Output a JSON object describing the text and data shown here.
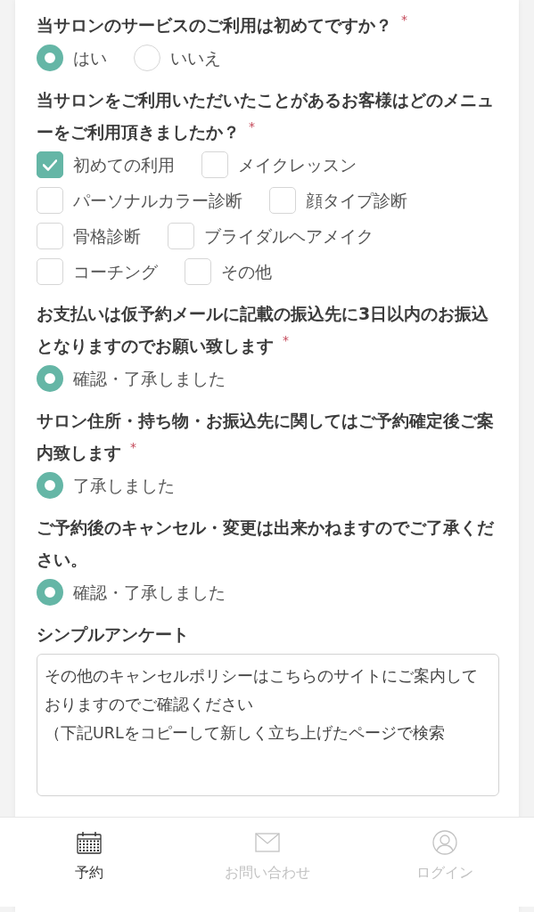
{
  "questions": [
    {
      "kind": "radio",
      "title": "当サロンのサービスのご利用は初めてですか？$^{*}$",
      "options": [
        {
          "label": "はい",
          "selected": true
        },
        {
          "label": "いいえ",
          "selected": false
        }
      ]
    },
    {
      "kind": "checkbox",
      "title": "当サロンをご利用いただいたことがあるお客様はどのメニューをご利用頂きましたか？$^{*}$",
      "options": [
        {
          "label": "初めての利用",
          "checked": true
        },
        {
          "label": "メイクレッスン",
          "checked": false
        },
        {
          "label": "パーソナルカラー診断",
          "checked": false
        },
        {
          "label": "顔タイプ診断",
          "checked": false
        },
        {
          "label": "骨格診断",
          "checked": false
        },
        {
          "label": "ブライダルヘアメイク",
          "checked": false
        },
        {
          "label": "コーチング",
          "checked": false
        },
        {
          "label": "その他",
          "checked": false
        }
      ]
    },
    {
      "kind": "radio",
      "title": "お支払いは仮予約メールに記載の振込先に3日以内のお振込となりますのでお願い致します$^{*}$",
      "options": [
        {
          "label": "確認・了承しました",
          "selected": true
        }
      ]
    },
    {
      "kind": "radio",
      "title": "サロン住所・持ち物・お振込先に関してはご予約確定後ご案内致します$^{*}$",
      "options": [
        {
          "label": "了承しました",
          "selected": true
        }
      ]
    },
    {
      "kind": "radio",
      "title": "ご予約後のキャンセル・変更は出来かねますのでご了承ください。",
      "options": [
        {
          "label": "確認・了承しました",
          "selected": true
        }
      ]
    }
  ],
  "survey": {
    "title": "シンプルアンケート",
    "lines": [
      "その他のキャンセルポリシーはこちらのサイトにご案内しておりますのでご確認ください",
      "（下記URLをコピーして新しく立ち上げたページで検索"
    ]
  },
  "tabs": [
    {
      "label": "予約",
      "selected": true
    },
    {
      "label": "お問い合わせ",
      "selected": false
    },
    {
      "label": "ログイン",
      "selected": false
    }
  ]
}
